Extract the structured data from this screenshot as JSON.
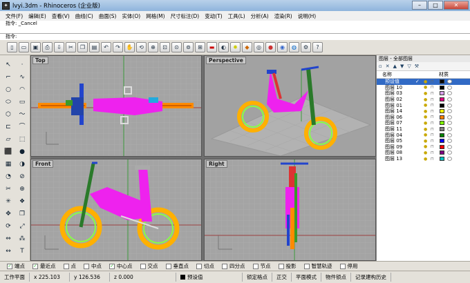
{
  "window": {
    "title": "lvyi.3dm - Rhinoceros (企业版)",
    "min": "–",
    "max": "□",
    "close": "✕"
  },
  "menu": [
    "文件(F)",
    "编辑(E)",
    "查看(V)",
    "曲线(C)",
    "曲面(S)",
    "实体(O)",
    "网格(M)",
    "尺寸标注(D)",
    "变动(T)",
    "工具(L)",
    "分析(A)",
    "渲染(R)",
    "说明(H)"
  ],
  "command": {
    "history": "指令: _Cancel",
    "prompt": "指令:"
  },
  "toolbar_icons": [
    "new-icon",
    "open-icon",
    "save-icon",
    "print-icon",
    "import-icon",
    "cut-icon",
    "copy-icon",
    "paste-icon",
    "undo-icon",
    "redo-icon",
    "pan-icon",
    "rotate-view-icon",
    "zoom-icon",
    "zoom-window-icon",
    "zoom-extents-icon",
    "zoom-selected-icon",
    "viewport-layout-icon",
    "render-car-icon",
    "display-mode-icon",
    "light-icon",
    "material-icon",
    "wireframe-icon",
    "shaded-icon",
    "rendered-icon",
    "globe-icon",
    "options-icon",
    "help-icon"
  ],
  "viewports": {
    "top": "Top",
    "perspective": "Perspective",
    "front": "Front",
    "right": "Right"
  },
  "panel": {
    "header": "图层 - 全部图层",
    "col_name": "名称",
    "col_material": "材质",
    "layers": [
      {
        "name": "预设值",
        "color": "#000000",
        "checked": "✓",
        "selected": true
      },
      {
        "name": "图层 10",
        "color": "#000000"
      },
      {
        "name": "图层 03",
        "color": "#d8a0e8"
      },
      {
        "name": "图层 02",
        "color": "#e00080"
      },
      {
        "name": "图层 01",
        "color": "#000000"
      },
      {
        "name": "图层 14",
        "color": "#ffff00"
      },
      {
        "name": "图层 06",
        "color": "#ff8000"
      },
      {
        "name": "图层 07",
        "color": "#80ff00"
      },
      {
        "name": "图层 11",
        "color": "#808080"
      },
      {
        "name": "图层 04",
        "color": "#008000"
      },
      {
        "name": "图层 05",
        "color": "#0000ff"
      },
      {
        "name": "图层 09",
        "color": "#ff0000"
      },
      {
        "name": "图层 08",
        "color": "#800080"
      },
      {
        "name": "图层 13",
        "color": "#00c0c0"
      }
    ]
  },
  "snaps": [
    {
      "label": "端点",
      "checked": true
    },
    {
      "label": "最近点",
      "checked": true
    },
    {
      "label": "点",
      "checked": false
    },
    {
      "label": "中点",
      "checked": false
    },
    {
      "label": "中心点",
      "checked": true
    },
    {
      "label": "交点",
      "checked": false
    },
    {
      "label": "垂直点",
      "checked": false
    },
    {
      "label": "切点",
      "checked": false
    },
    {
      "label": "四分点",
      "checked": false
    },
    {
      "label": "节点",
      "checked": false
    },
    {
      "label": "投影",
      "checked": false
    },
    {
      "label": "智慧轨迹",
      "checked": false
    },
    {
      "label": "停用",
      "checked": false
    }
  ],
  "status": {
    "plane": "工作平面",
    "x": "x 225.103",
    "y": "y 126.536",
    "z": "z 0.000",
    "layer": "预设值",
    "grid": "锁定格点",
    "ortho": "正交",
    "planar": "平面模式",
    "osnap": "物件锁点",
    "history": "记录建构历史"
  }
}
